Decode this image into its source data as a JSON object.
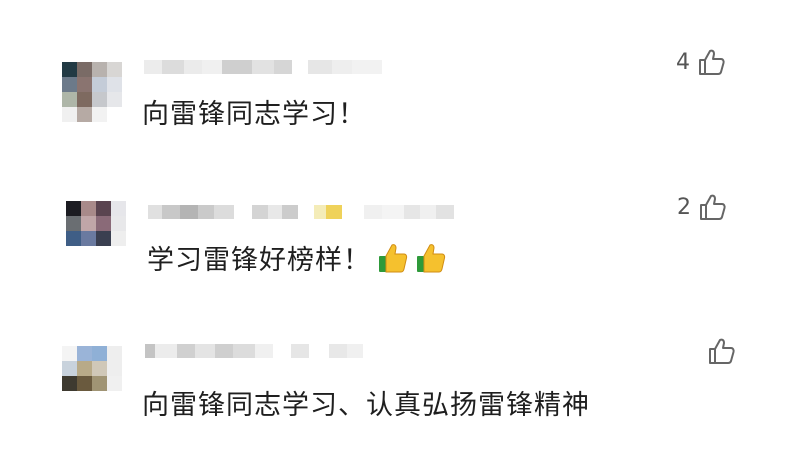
{
  "comments": [
    {
      "text": "向雷锋同志学习！",
      "likes": "4",
      "avatar_colors": [
        "#223a44",
        "#7a6b66",
        "#b8b2ae",
        "#d8d6d4",
        "#6c7a8a",
        "#8a7470",
        "#c4ccd8",
        "#dfe2e8",
        "#aeb6a8",
        "#7e6a60",
        "#c6c8cc",
        "#e6e7ea",
        "#f0f0f0",
        "#b6aaa4",
        "#f2f2f2",
        "#ffffff"
      ]
    },
    {
      "text": "学习雷锋好榜样！",
      "likes": "2",
      "emojis": [
        "thumbs-up-emoji",
        "thumbs-up-emoji"
      ],
      "avatar_colors": [
        "#1c1c22",
        "#a88a8a",
        "#5a4450",
        "#e6e6ea",
        "#6a6e72",
        "#c0a6a8",
        "#8a6a78",
        "#e8e8ea",
        "#3f5e86",
        "#6a7aa0",
        "#3a3f50",
        "#eeeeee",
        "#ffffff",
        "#ffffff",
        "#ffffff",
        "#ffffff"
      ]
    },
    {
      "text": "向雷锋同志学习、认真弘扬雷锋精神",
      "likes": "",
      "avatar_colors": [
        "#f4f4f4",
        "#9ab4d8",
        "#8fb0d6",
        "#eeeeee",
        "#c8d2dc",
        "#b8aa88",
        "#d0c8b8",
        "#eeeeee",
        "#3e3a30",
        "#6a5a3e",
        "#a09474",
        "#f0f0f0",
        "#ffffff",
        "#ffffff",
        "#ffffff",
        "#ffffff"
      ]
    }
  ]
}
